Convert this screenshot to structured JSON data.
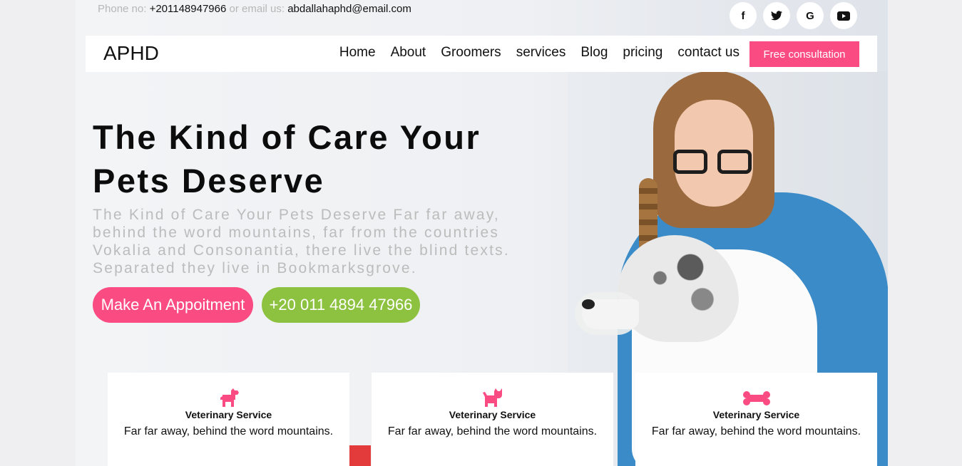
{
  "contact": {
    "phone_label": "Phone no:",
    "phone": "+201148947966",
    "email_label": "or email us:",
    "email": "abdallahaphd@email.com"
  },
  "socials": [
    {
      "icon": "facebook-icon",
      "glyph": "f"
    },
    {
      "icon": "twitter-icon",
      "glyph": "🐦"
    },
    {
      "icon": "google-icon",
      "glyph": "G"
    },
    {
      "icon": "youtube-icon",
      "glyph": "▶"
    }
  ],
  "nav": {
    "logo": "APHD",
    "items": [
      "Home",
      "About",
      "Groomers",
      "services",
      "Blog",
      "pricing",
      "contact us"
    ],
    "cta": "Free consultation"
  },
  "hero": {
    "title": "The Kind of Care Your Pets Deserve",
    "lead": "The Kind of Care Your Pets Deserve Far far away, behind the word mountains, far from the countries Vokalia and Consonantia, there live the blind texts. Separated they live in Bookmarksgrove.",
    "btn_appointment": "Make An Appoitment",
    "btn_phone": "+20 011 4894 47966"
  },
  "cards": [
    {
      "icon": "dog-icon",
      "title": "Veterinary Service",
      "text": "Far far away, behind the word mountains."
    },
    {
      "icon": "cat-icon",
      "title": "Veterinary Service",
      "text": "Far far away, behind the word mountains."
    },
    {
      "icon": "bone-icon",
      "title": "Veterinary Service",
      "text": "Far far away, behind the word mountains."
    }
  ],
  "colors": {
    "accent": "#fb4b83",
    "green": "#8cc23f"
  }
}
